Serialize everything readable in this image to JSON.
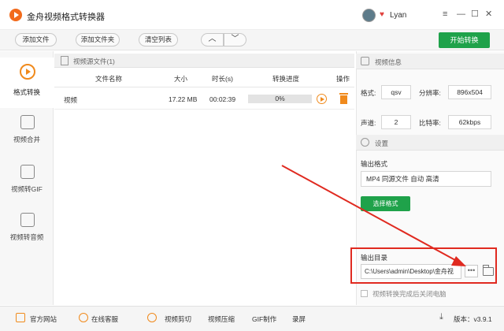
{
  "app": {
    "title": "金舟视频格式转换器"
  },
  "user": {
    "name": "Lyan"
  },
  "window_controls": {
    "menu": "≡",
    "minimize": "—",
    "maximize": "☐",
    "close": "✕"
  },
  "toolbar": {
    "add_file": "添加文件",
    "add_folder": "添加文件夹",
    "clear_list": "清空列表",
    "move_up": "︿",
    "move_down": "﹀",
    "start": "开始转换"
  },
  "sidebar": {
    "items": [
      {
        "label": "格式转换",
        "icon": "format-convert-icon",
        "active": true
      },
      {
        "label": "视频合并",
        "icon": "video-merge-icon",
        "active": false
      },
      {
        "label": "视频转GIF",
        "icon": "video-to-gif-icon",
        "active": false
      },
      {
        "label": "视频转音频",
        "icon": "video-to-audio-icon",
        "active": false
      }
    ]
  },
  "file_list": {
    "header": "视频源文件(1)",
    "columns": {
      "name": "文件名称",
      "size": "大小",
      "duration": "时长(s)",
      "progress": "转换进度",
      "action": "操作"
    },
    "rows": [
      {
        "name": "视频",
        "size": "17.22 MB",
        "duration": "00:02:39",
        "progress": "0%",
        "progress_value": 0
      }
    ]
  },
  "video_info": {
    "title": "视频信息",
    "format_label": "格式:",
    "format": "qsv",
    "resolution_label": "分辨率:",
    "resolution": "896x504",
    "channel_label": "声道:",
    "channel": "2",
    "bitrate_label": "比特率:",
    "bitrate": "62kbps"
  },
  "settings": {
    "title": "设置",
    "output_format_label": "输出格式",
    "output_format": "MP4 同源文件 自动 高清",
    "choose_format": "选择格式",
    "output_dir_label": "输出目录",
    "output_dir": "C:\\Users\\admin\\Desktop\\金舟视",
    "browse": "•••",
    "shutdown_label": "视频转换完成后关闭电脑"
  },
  "footer": {
    "website": "官方网站",
    "service": "在线客服",
    "cut": "视频剪切",
    "compress": "视频压缩",
    "gif": "GIF制作",
    "record": "录屏",
    "version": "版本：v3.9.1"
  },
  "colors": {
    "accent_green": "#1fa24a",
    "accent_orange": "#f08a1c",
    "annotation_red": "#e02a20"
  }
}
